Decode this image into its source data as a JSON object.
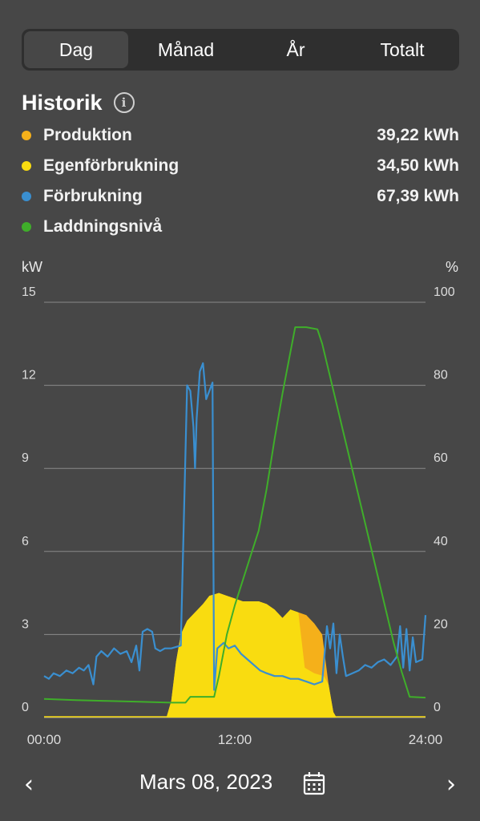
{
  "tabs": [
    {
      "label": "Dag",
      "active": true
    },
    {
      "label": "Månad",
      "active": false
    },
    {
      "label": "År",
      "active": false
    },
    {
      "label": "Totalt",
      "active": false
    }
  ],
  "section": {
    "title": "Historik",
    "info_icon": "info-icon"
  },
  "legend": [
    {
      "label": "Produktion",
      "value": "39,22 kWh",
      "color": "#f5b01a"
    },
    {
      "label": "Egenförbrukning",
      "value": "34,50 kWh",
      "color": "#f9dc10"
    },
    {
      "label": "Förbrukning",
      "value": "67,39 kWh",
      "color": "#3a8fd0"
    },
    {
      "label": "Laddningsnivå",
      "value": "",
      "color": "#3fae2a"
    }
  ],
  "chart_data": {
    "type": "line",
    "left_unit": "kW",
    "right_unit": "%",
    "left_ticks": [
      "15",
      "12",
      "9",
      "6",
      "3",
      "0"
    ],
    "right_ticks": [
      "100",
      "80",
      "60",
      "40",
      "20",
      "0"
    ],
    "x_ticks": [
      "00:00",
      "12:00",
      "24:00"
    ],
    "ylim_left": [
      0,
      15
    ],
    "ylim_right": [
      0,
      100
    ],
    "xlim_hours": [
      0,
      24
    ],
    "grid": true,
    "series": [
      {
        "name": "Förbrukning",
        "axis": "left",
        "color": "#3a8fd0",
        "points": [
          [
            0,
            1.5
          ],
          [
            0.3,
            1.4
          ],
          [
            0.6,
            1.6
          ],
          [
            1,
            1.5
          ],
          [
            1.4,
            1.7
          ],
          [
            1.8,
            1.6
          ],
          [
            2.2,
            1.8
          ],
          [
            2.5,
            1.7
          ],
          [
            2.8,
            1.9
          ],
          [
            3.1,
            1.2
          ],
          [
            3.3,
            2.2
          ],
          [
            3.6,
            2.4
          ],
          [
            4,
            2.2
          ],
          [
            4.4,
            2.5
          ],
          [
            4.8,
            2.3
          ],
          [
            5.2,
            2.4
          ],
          [
            5.5,
            2.0
          ],
          [
            5.8,
            2.6
          ],
          [
            6,
            1.7
          ],
          [
            6.2,
            3.1
          ],
          [
            6.5,
            3.2
          ],
          [
            6.8,
            3.1
          ],
          [
            7,
            2.5
          ],
          [
            7.3,
            2.4
          ],
          [
            7.6,
            2.5
          ],
          [
            8,
            2.5
          ],
          [
            8.6,
            2.6
          ],
          [
            9.0,
            12.0
          ],
          [
            9.2,
            11.8
          ],
          [
            9.4,
            10.5
          ],
          [
            9.5,
            9.0
          ],
          [
            9.6,
            10.8
          ],
          [
            9.8,
            12.5
          ],
          [
            10.0,
            12.8
          ],
          [
            10.2,
            11.5
          ],
          [
            10.4,
            11.8
          ],
          [
            10.6,
            12.1
          ],
          [
            10.7,
            1.0
          ],
          [
            10.9,
            2.5
          ],
          [
            11.3,
            2.7
          ],
          [
            11.6,
            2.5
          ],
          [
            12.0,
            2.6
          ],
          [
            12.4,
            2.3
          ],
          [
            12.8,
            2.1
          ],
          [
            13.2,
            1.9
          ],
          [
            13.6,
            1.7
          ],
          [
            14.0,
            1.6
          ],
          [
            14.5,
            1.5
          ],
          [
            15.0,
            1.5
          ],
          [
            15.5,
            1.4
          ],
          [
            16.0,
            1.4
          ],
          [
            16.5,
            1.3
          ],
          [
            17.0,
            1.2
          ],
          [
            17.5,
            1.3
          ],
          [
            17.8,
            3.3
          ],
          [
            18.0,
            2.5
          ],
          [
            18.2,
            3.4
          ],
          [
            18.4,
            1.6
          ],
          [
            18.6,
            3.0
          ],
          [
            18.8,
            2.2
          ],
          [
            19.0,
            1.5
          ],
          [
            19.4,
            1.6
          ],
          [
            19.8,
            1.7
          ],
          [
            20.2,
            1.9
          ],
          [
            20.6,
            1.8
          ],
          [
            21.0,
            2.0
          ],
          [
            21.4,
            2.1
          ],
          [
            21.8,
            1.9
          ],
          [
            22.2,
            2.2
          ],
          [
            22.4,
            3.3
          ],
          [
            22.6,
            1.8
          ],
          [
            22.8,
            3.2
          ],
          [
            23.0,
            1.7
          ],
          [
            23.2,
            2.9
          ],
          [
            23.4,
            2.0
          ],
          [
            23.8,
            2.1
          ],
          [
            24.0,
            3.7
          ]
        ]
      },
      {
        "name": "Laddningsnivå",
        "axis": "right",
        "color": "#3fae2a",
        "points": [
          [
            0,
            4.5
          ],
          [
            2,
            4.2
          ],
          [
            4,
            4.0
          ],
          [
            6,
            3.8
          ],
          [
            8,
            3.6
          ],
          [
            8.9,
            3.6
          ],
          [
            9.2,
            5.0
          ],
          [
            10.0,
            5.0
          ],
          [
            10.7,
            5.0
          ],
          [
            11.0,
            10
          ],
          [
            11.5,
            20
          ],
          [
            12.0,
            27
          ],
          [
            12.5,
            33
          ],
          [
            13.0,
            39
          ],
          [
            13.5,
            45
          ],
          [
            14.0,
            55
          ],
          [
            14.5,
            67
          ],
          [
            15.0,
            78
          ],
          [
            15.5,
            88
          ],
          [
            15.8,
            94
          ],
          [
            16.5,
            94
          ],
          [
            17.2,
            93.5
          ],
          [
            17.5,
            90
          ],
          [
            18.0,
            82
          ],
          [
            18.5,
            74
          ],
          [
            19.0,
            66
          ],
          [
            19.5,
            58
          ],
          [
            20.0,
            50
          ],
          [
            20.5,
            42
          ],
          [
            21.0,
            34
          ],
          [
            21.5,
            26
          ],
          [
            22.0,
            18
          ],
          [
            22.5,
            11
          ],
          [
            23.0,
            5
          ],
          [
            24.0,
            4.8
          ]
        ]
      },
      {
        "name": "Produktion",
        "axis": "left",
        "color": "#f5b01a",
        "points": [
          [
            7.7,
            0
          ],
          [
            8.0,
            0.6
          ],
          [
            8.3,
            2.0
          ],
          [
            8.6,
            3.0
          ],
          [
            9.0,
            3.5
          ],
          [
            9.5,
            3.8
          ],
          [
            10,
            4.1
          ],
          [
            10.4,
            4.4
          ],
          [
            11.0,
            4.5
          ],
          [
            11.5,
            4.4
          ],
          [
            12.0,
            4.3
          ],
          [
            12.5,
            4.2
          ],
          [
            13,
            4.2
          ],
          [
            13.5,
            4.2
          ],
          [
            14,
            4.1
          ],
          [
            14.5,
            3.9
          ],
          [
            15,
            3.6
          ],
          [
            15.5,
            3.9
          ],
          [
            16,
            3.8
          ],
          [
            16.5,
            3.7
          ],
          [
            17,
            3.4
          ],
          [
            17.5,
            3.0
          ],
          [
            17.9,
            1.2
          ],
          [
            18.2,
            0.2
          ],
          [
            18.4,
            0
          ]
        ]
      },
      {
        "name": "Egenförbrukning",
        "axis": "left",
        "color": "#f9dc10",
        "points": [
          [
            7.7,
            0
          ],
          [
            8.0,
            0.6
          ],
          [
            8.3,
            2.0
          ],
          [
            8.6,
            3.0
          ],
          [
            9.0,
            3.5
          ],
          [
            9.5,
            3.8
          ],
          [
            10,
            4.1
          ],
          [
            10.4,
            4.4
          ],
          [
            11.0,
            4.5
          ],
          [
            11.5,
            4.4
          ],
          [
            12.0,
            4.3
          ],
          [
            12.5,
            4.2
          ],
          [
            13,
            4.2
          ],
          [
            13.5,
            4.2
          ],
          [
            14,
            4.1
          ],
          [
            14.5,
            3.9
          ],
          [
            15,
            3.6
          ],
          [
            15.5,
            3.9
          ],
          [
            16,
            3.8
          ],
          [
            16.4,
            1.8
          ],
          [
            17,
            1.6
          ],
          [
            17.6,
            1.5
          ],
          [
            17.9,
            1.2
          ],
          [
            18.2,
            0.2
          ],
          [
            18.4,
            0
          ]
        ]
      }
    ]
  },
  "date_nav": {
    "label": "Mars 08, 2023",
    "prev_icon": "chevron-left-icon",
    "next_icon": "chevron-right-icon",
    "calendar_icon": "calendar-icon"
  }
}
